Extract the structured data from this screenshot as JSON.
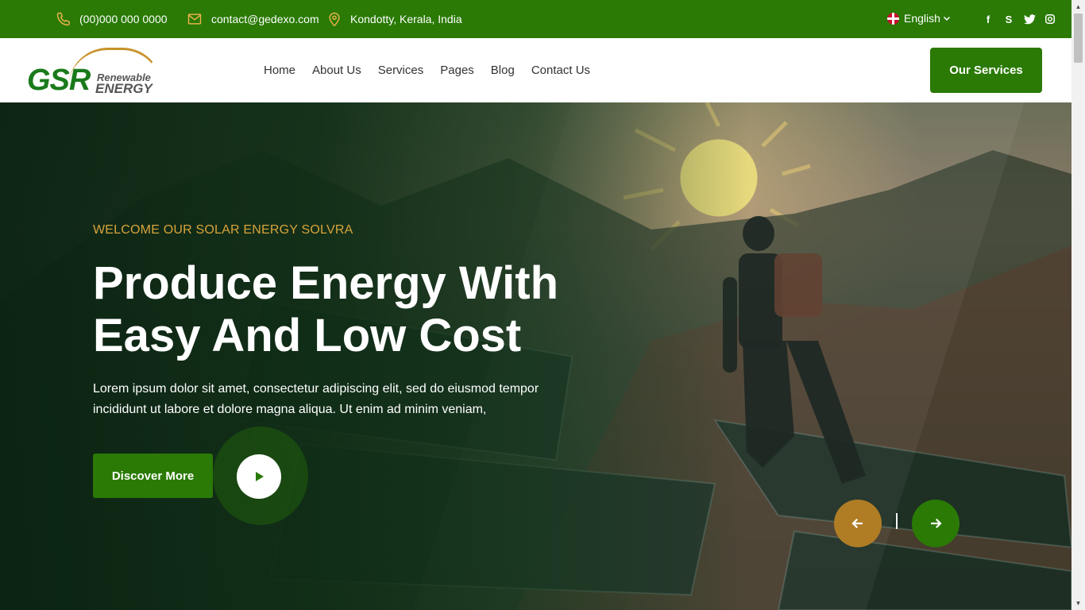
{
  "topbar": {
    "phone": "(00)000 000 0000",
    "email": "contact@gedexo.com",
    "location": "Kondotty,  Kerala, India",
    "language": "English",
    "socials": [
      "facebook-icon",
      "skype-icon",
      "twitter-icon",
      "instagram-icon"
    ]
  },
  "header": {
    "logo_main": "GSR",
    "logo_line1": "Renewable",
    "logo_line2": "ENERGY",
    "nav": [
      "Home",
      "About Us",
      "Services",
      "Pages",
      "Blog",
      "Contact Us"
    ],
    "cta": "Our Services"
  },
  "hero": {
    "subtitle": "WELCOME OUR SOLAR ENERGY SOLVRA",
    "title_line1": "Produce Energy With",
    "title_line2": "Easy And Low Cost",
    "description": "Lorem ipsum dolor sit amet, consectetur adipiscing elit, sed do eiusmod tempor incididunt ut labore et dolore magna aliqua. Ut enim ad minim veniam,",
    "button": "Discover More"
  },
  "colors": {
    "brand_green": "#2a7a05",
    "accent_gold": "#b07d25",
    "subtitle_gold": "#d8a43a"
  }
}
